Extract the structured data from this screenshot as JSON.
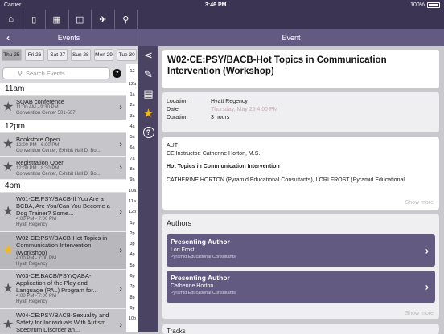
{
  "status": {
    "carrier": "Carrier",
    "time": "3:46 PM",
    "battery": "100%"
  },
  "topbar_icons": [
    "home-icon",
    "phone-icon",
    "grid-icon",
    "easel-icon",
    "airplane-icon",
    "search-icon"
  ],
  "nav": {
    "back": "‹",
    "left_title": "Events",
    "right_title": "Event"
  },
  "days": [
    "Thu 25",
    "Fri 26",
    "Sat 27",
    "Sun 28",
    "Mon 29",
    "Tue 30"
  ],
  "search": {
    "placeholder": "Search Events"
  },
  "hours": [
    "12",
    "12a",
    "1a",
    "2a",
    "3a",
    "4a",
    "5a",
    "6a",
    "7a",
    "8a",
    "9a",
    "10a",
    "11a",
    "12p",
    "1p",
    "2p",
    "3p",
    "4p",
    "5p",
    "6p",
    "7p",
    "8p",
    "9p",
    "10p"
  ],
  "list": {
    "h11": "11am",
    "h12": "12pm",
    "h4": "4pm",
    "e1": {
      "title": "SQAB conference",
      "time": "11:00 AM - 9:30 PM",
      "loc": "Convention Center 501-507"
    },
    "e2": {
      "title": "Bookstore Open",
      "time": "12:00 PM - 6:00 PM",
      "loc": "Convention Center, Exhibit Hall D, Bo..."
    },
    "e3": {
      "title": "Registration Open",
      "time": "12:00 PM - 8:30 PM",
      "loc": "Convention Center, Exhibit Hall D, Bo..."
    },
    "e4": {
      "title": "W01-CE:PSY/BACB-If You Are a BCBA, Are You/Can You Become a Dog Trainer? Some...",
      "time": "4:00 PM - 7:00 PM",
      "loc": "Hyatt Regency"
    },
    "e5": {
      "title": "W02-CE:PSY/BACB-Hot Topics in Communication Intervention (Workshop)",
      "time": "4:00 PM - 7:00 PM",
      "loc": "Hyatt Regency"
    },
    "e6": {
      "title": "W03-CE:BACB/PSY/QABA-Application of the Play and Language (PAL) Program for...",
      "time": "4:00 PM - 7:00 PM",
      "loc": "Hyatt Regency"
    },
    "e7": {
      "title": "W04-CE:PSY/BACB-Sexuality and Safety for Individuals With Autism Spectrum Disorder an...",
      "time": "",
      "loc": ""
    }
  },
  "detail": {
    "title": "W02-CE:PSY/BACB-Hot Topics in Communication Intervention (Workshop)",
    "location_k": "Location",
    "location_v": "Hyatt Regency",
    "date_k": "Date",
    "date_v": "Thursday, May 25 4:00 PM",
    "duration_k": "Duration",
    "duration_v": "3 hours",
    "d1": "AUT",
    "d2": "CE Instructor: Catherine Horton, M.S.",
    "d3": "Hot Topics in Communication Intervention",
    "d4": "CATHERINE HORTON (Pyramid Educational Consultants), LORI FROST (Pyramid Educational",
    "show_more": "Show more",
    "authors_hd": "Authors",
    "a1": {
      "role": "Presenting Author",
      "name": "Lori Frost",
      "org": "Pyramid Educational Consultants"
    },
    "a2": {
      "role": "Presenting Author",
      "name": "Catherine Horton",
      "org": "Pyramid Educational Consultants"
    },
    "show_more2": "Show more",
    "tracks": "Tracks"
  },
  "colors": {
    "header": "#3b3553",
    "nav": "#625a80",
    "star_gold": "#f2b81c"
  }
}
